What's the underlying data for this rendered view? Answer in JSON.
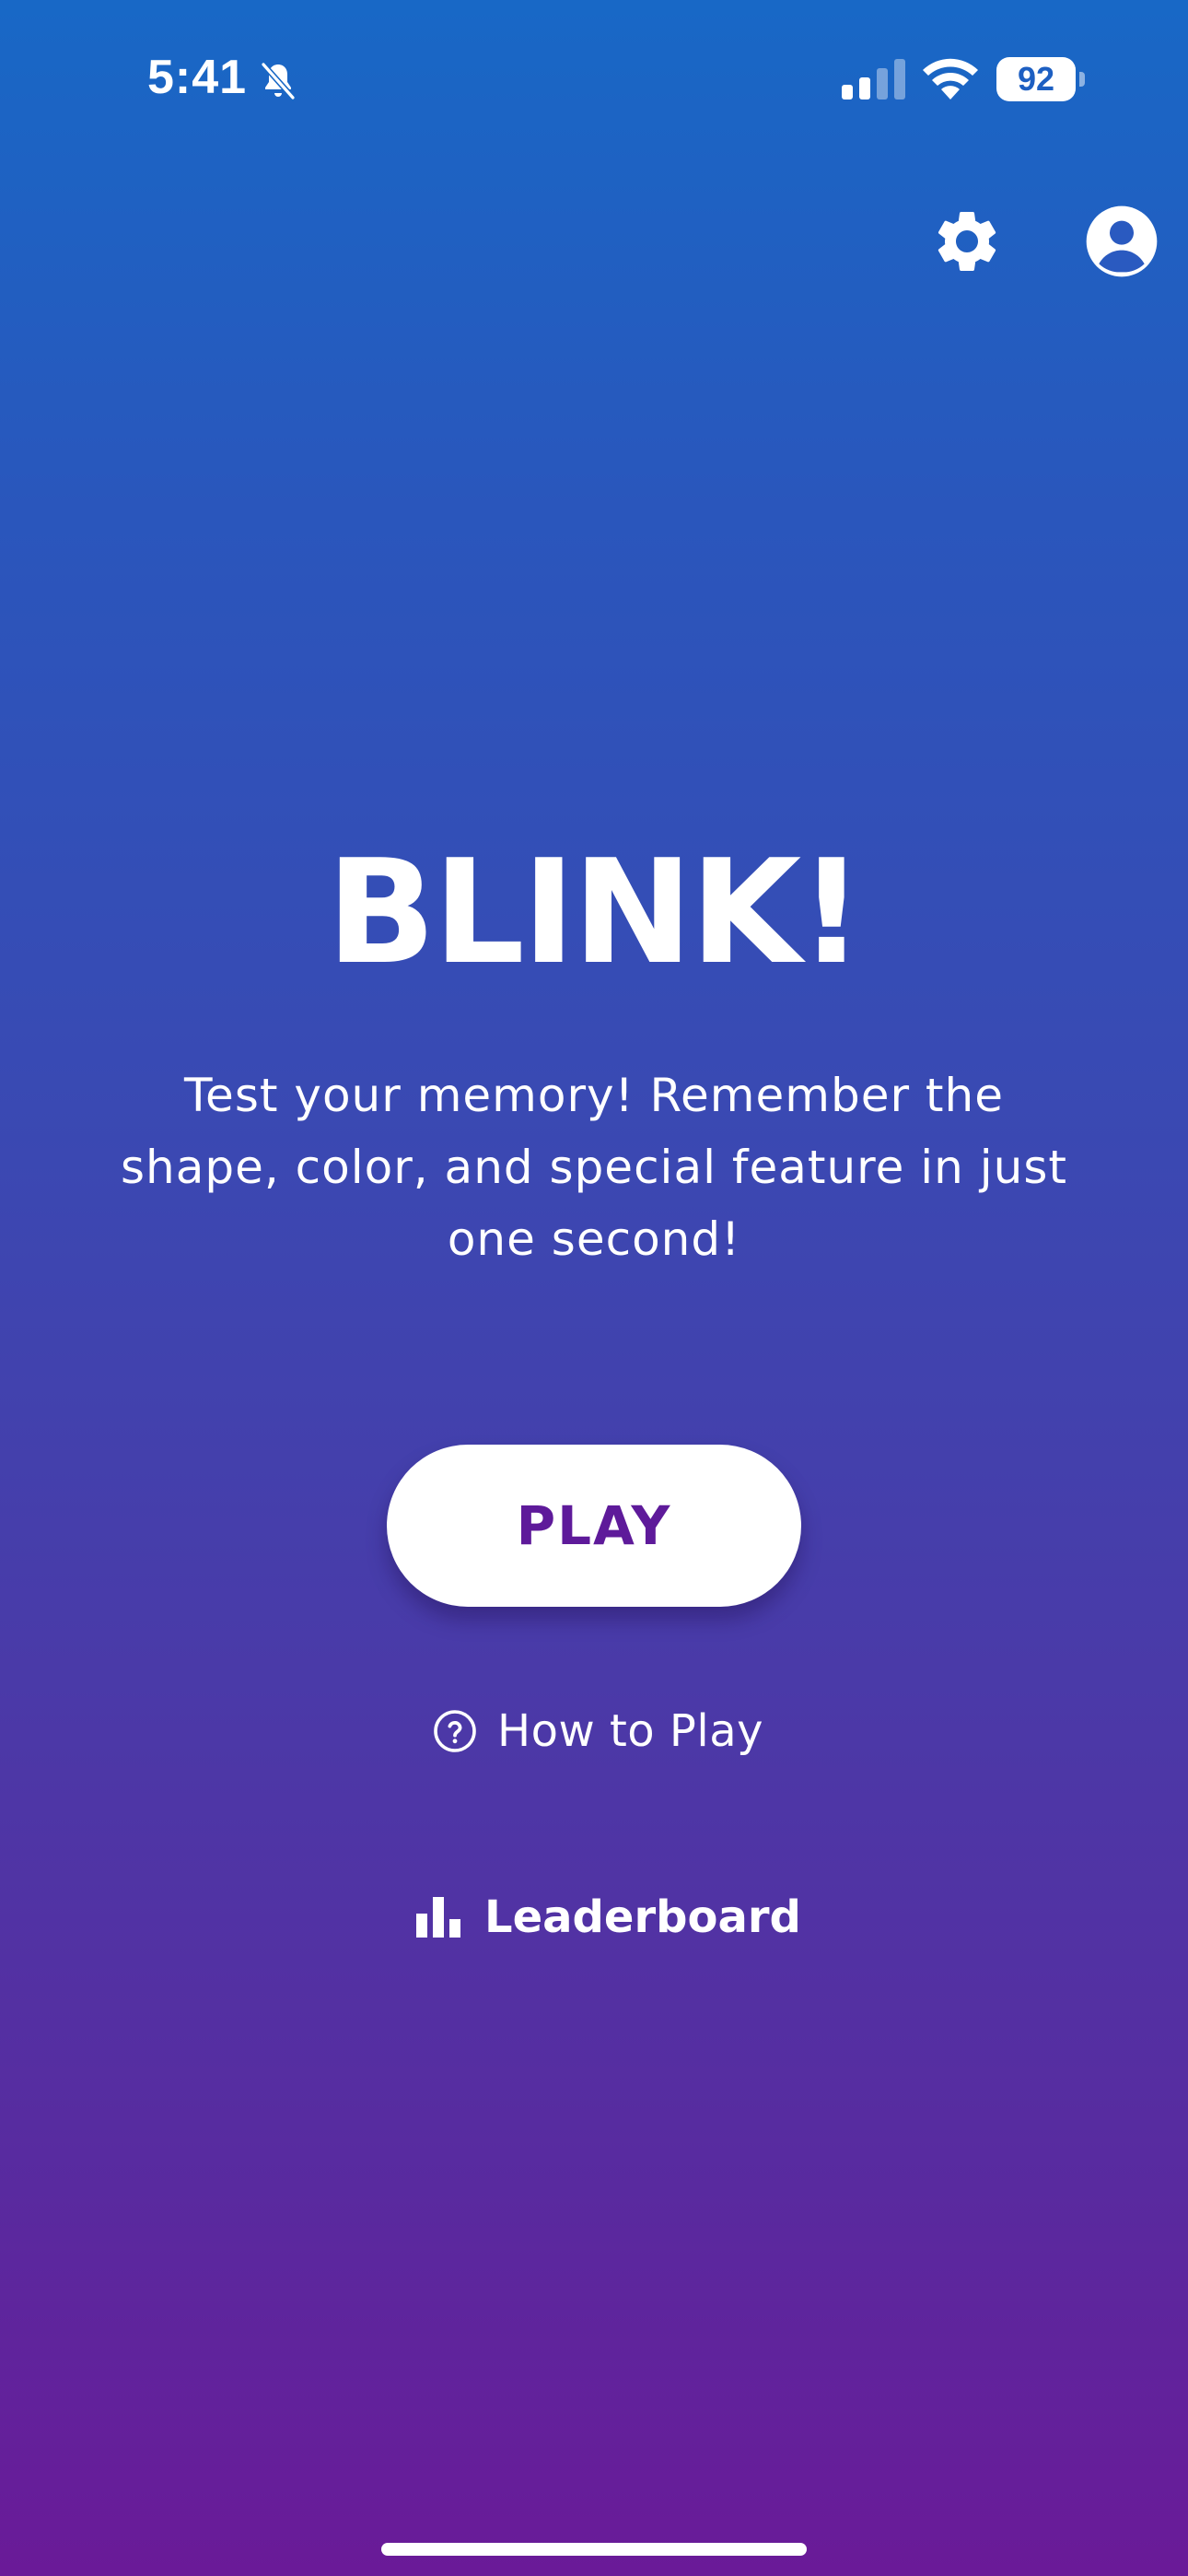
{
  "status_bar": {
    "time": "5:41",
    "battery_level": "92",
    "icons": [
      "bell-slash-icon",
      "cellular-signal-icon",
      "wifi-icon",
      "battery-icon"
    ]
  },
  "header": {
    "settings_icon": "gear-icon",
    "profile_icon": "user-circle-icon"
  },
  "main": {
    "title": "BLINK!",
    "subtitle": "Test your memory! Remember the shape, color, and special feature in just one second!",
    "play_label": "PLAY",
    "how_to_play_label": "How to Play",
    "how_to_play_icon": "question-circle-icon",
    "leaderboard_label": "Leaderboard",
    "leaderboard_icon": "bar-chart-icon"
  },
  "colors": {
    "gradient_top": "#1868c6",
    "gradient_bottom": "#6a1a98",
    "play_text": "#5e1a9a",
    "button_bg": "#ffffff"
  }
}
